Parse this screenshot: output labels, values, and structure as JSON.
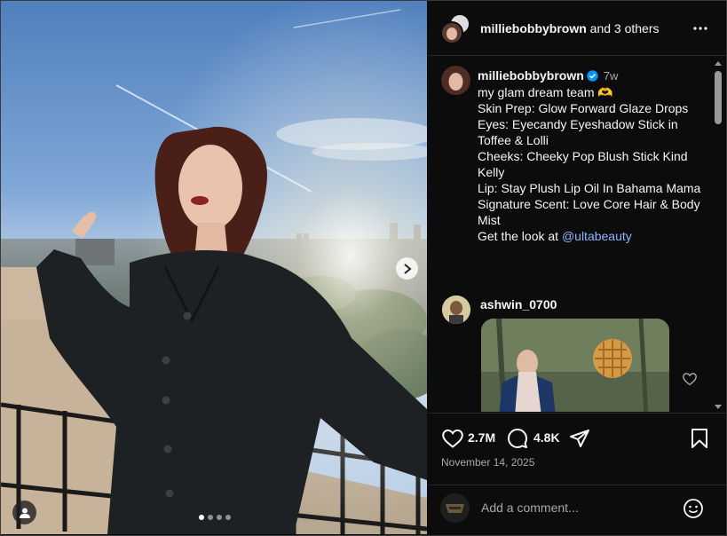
{
  "header": {
    "username": "milliebobbybrown",
    "others": "and 3 others",
    "more_icon": "more-horizontal-icon"
  },
  "caption": {
    "username": "milliebobbybrown",
    "verified": true,
    "time": "7w",
    "lines": [
      "my glam dream team 🫶",
      "",
      "Skin Prep: Glow Forward Glaze Drops",
      "Eyes: Eyecandy Eyeshadow Stick in Toffee & Lolli",
      "Cheeks: Cheeky Pop Blush Stick Kind Kelly",
      "Lip: Stay Plush Lip Oil In Bahama Mama",
      "Signature Scent: Love Core Hair & Body Mist",
      ""
    ],
    "cta_prefix": "Get the look at ",
    "mention": "@ultabeauty"
  },
  "comment": {
    "username": "ashwin_0700",
    "like_icon": "heart-outline-icon"
  },
  "actions": {
    "likes": "2.7M",
    "comments": "4.8K",
    "date": "November 14, 2025"
  },
  "comment_box": {
    "placeholder": "Add a comment..."
  },
  "carousel": {
    "slides": 4,
    "active_slide": 1
  },
  "colors": {
    "background": "#0c0c0c",
    "link": "#8eb4ff",
    "verified": "#0095f6",
    "muted": "#a8a8a8"
  }
}
